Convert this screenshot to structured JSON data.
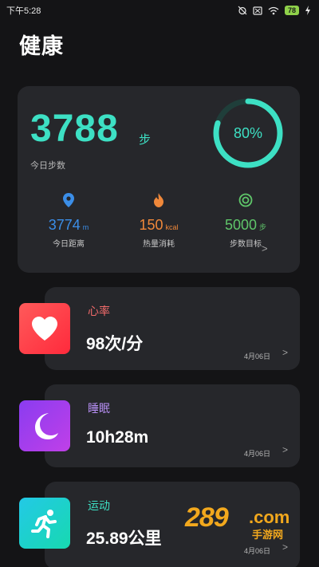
{
  "status_bar": {
    "time": "下午5:28",
    "battery": "78"
  },
  "page_title": "健康",
  "summary": {
    "steps_value": "3788",
    "steps_unit": "步",
    "steps_label": "今日步数",
    "goal_percent": "80%",
    "goal_progress": 0.8,
    "stats": [
      {
        "value": "3774",
        "unit": "m",
        "label": "今日距离",
        "color": "#3b8ee8",
        "icon": "location-pin-icon"
      },
      {
        "value": "150",
        "unit": "kcal",
        "label": "热量消耗",
        "color": "#f0883a",
        "icon": "flame-icon"
      },
      {
        "value": "5000",
        "unit": "步",
        "label": "步数目标",
        "color": "#5fc66a",
        "icon": "target-icon"
      }
    ]
  },
  "metrics": [
    {
      "title": "心率",
      "value": "98次/分",
      "date": "4月06日",
      "title_color": "#f06a6a",
      "icon": "heart-icon"
    },
    {
      "title": "睡眠",
      "value": "10h28m",
      "date": "4月06日",
      "title_color": "#b58ef2",
      "icon": "moon-icon"
    },
    {
      "title": "运动",
      "value": "25.89公里",
      "date": "4月06日",
      "title_color": "#3de0c4",
      "icon": "running-icon"
    }
  ],
  "watermark": {
    "number": "289",
    "domain": ".com",
    "text": "手游网"
  }
}
